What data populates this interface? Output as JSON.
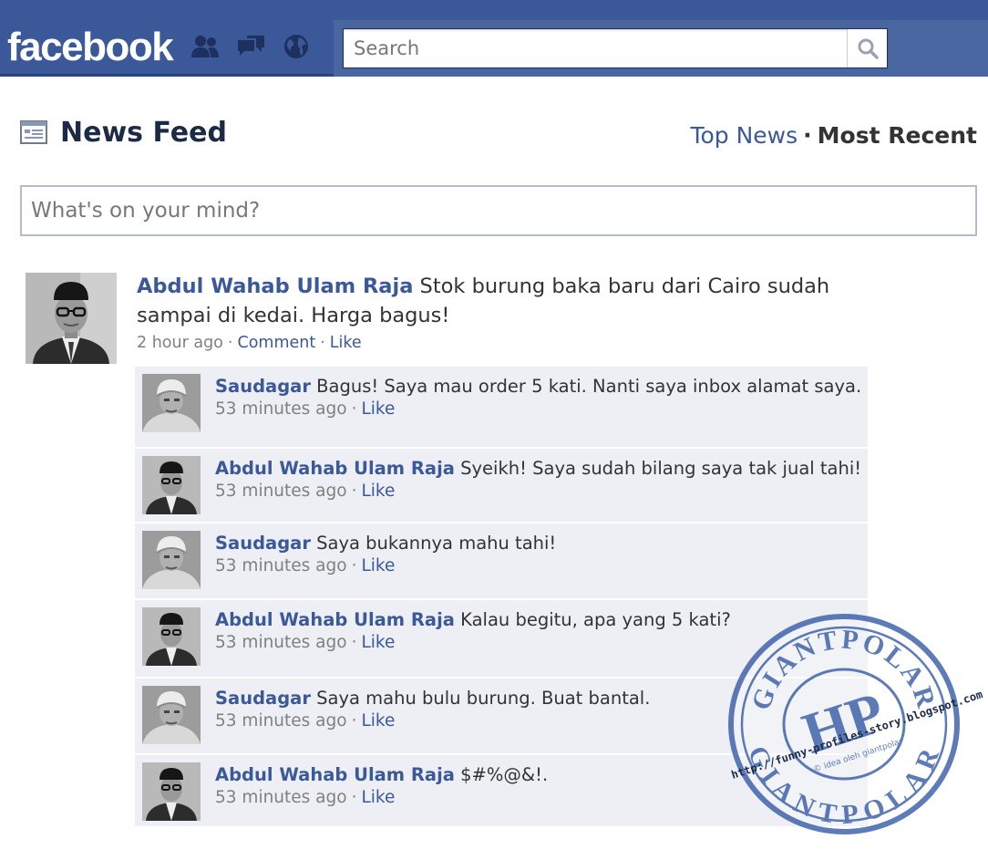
{
  "header": {
    "logo": "facebook",
    "search": {
      "placeholder": "Search"
    }
  },
  "feed": {
    "title": "News Feed",
    "tabs": {
      "top_news": "Top News",
      "separator": "·",
      "most_recent": "Most Recent"
    },
    "composer_placeholder": "What's on your mind?"
  },
  "story": {
    "author": "Abdul Wahab Ulam Raja",
    "text": "Stok burung baka baru dari Cairo sudah sampai di kedai. Harga bagus!",
    "time": "2 hour ago",
    "actions": {
      "comment": "Comment",
      "like": "Like"
    }
  },
  "comments": [
    {
      "author": "Saudagar",
      "text": "Bagus! Saya mau order 5 kati. Nanti saya inbox alamat saya.",
      "time": "53 minutes ago",
      "like": "Like"
    },
    {
      "author": "Abdul Wahab Ulam Raja",
      "text": "Syeikh! Saya sudah bilang saya tak jual tahi!",
      "time": "53 minutes ago",
      "like": "Like"
    },
    {
      "author": "Saudagar",
      "text": "Saya bukannya mahu tahi!",
      "time": "53 minutes ago",
      "like": "Like"
    },
    {
      "author": "Abdul Wahab Ulam Raja",
      "text": "Kalau begitu, apa yang 5 kati?",
      "time": "53 minutes ago",
      "like": "Like"
    },
    {
      "author": "Saudagar",
      "text": "Saya mahu bulu burung. Buat bantal.",
      "time": "53 minutes ago",
      "like": "Like"
    },
    {
      "author": "Abdul Wahab Ulam Raja",
      "text": "$#%@&!.",
      "time": "53 minutes ago",
      "like": "Like"
    }
  ],
  "stamp": {
    "top_arc": "GIANTPOLAR",
    "bottom_arc": "GIANTPOLAR",
    "monogram": "HP",
    "url": "http://funny-profiles-story.blogspot.com/",
    "credit": "© idea oleh giantpolar"
  },
  "colors": {
    "bar": "#3b5998",
    "link": "#3b5998",
    "comment_bg": "#edeff4",
    "stamp": "#3a5fa8"
  }
}
